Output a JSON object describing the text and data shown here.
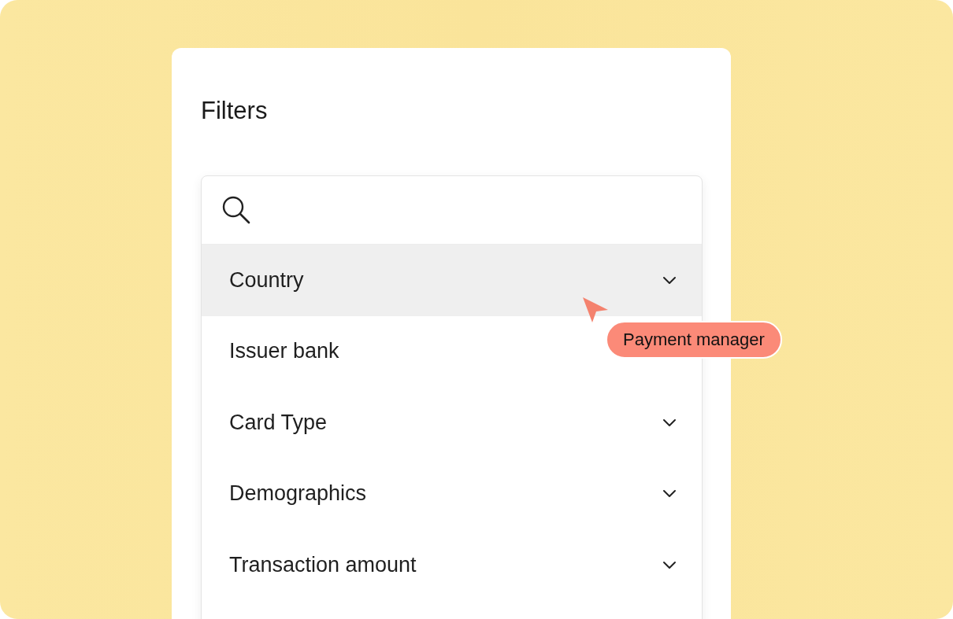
{
  "panel": {
    "title": "Filters"
  },
  "filter_list": [
    {
      "label": "Country",
      "selected": true
    },
    {
      "label": "Issuer bank",
      "selected": false
    },
    {
      "label": "Card Type",
      "selected": false
    },
    {
      "label": "Demographics",
      "selected": false
    },
    {
      "label": "Transaction amount",
      "selected": false
    }
  ],
  "cursor_tag": {
    "label": "Payment manager"
  }
}
